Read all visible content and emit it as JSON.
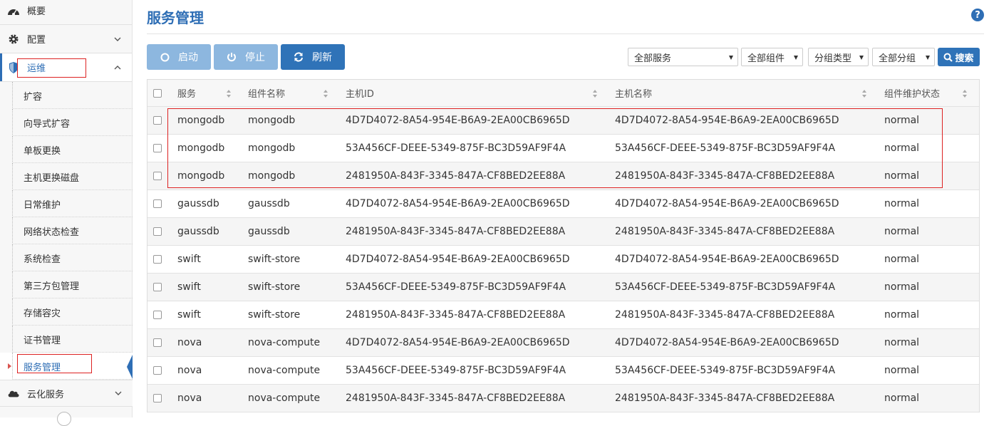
{
  "sidebar": {
    "overview": "概要",
    "config": "配置",
    "ops": "运维",
    "ops_items": [
      {
        "label": "扩容"
      },
      {
        "label": "向导式扩容"
      },
      {
        "label": "单板更换"
      },
      {
        "label": "主机更换磁盘"
      },
      {
        "label": "日常维护"
      },
      {
        "label": "网络状态检查"
      },
      {
        "label": "系统检查"
      },
      {
        "label": "第三方包管理"
      },
      {
        "label": "存储容灾"
      },
      {
        "label": "证书管理"
      },
      {
        "label": "服务管理"
      }
    ],
    "active_item": "服务管理",
    "cloud": "云化服务"
  },
  "page": {
    "title": "服务管理",
    "help": "?"
  },
  "toolbar": {
    "start": "启动",
    "stop": "停止",
    "refresh": "刷新"
  },
  "filters": {
    "service": "全部服务",
    "component": "全部组件",
    "group_type": "分组类型",
    "group": "全部分组",
    "search": "搜索"
  },
  "table": {
    "headers": [
      "服务",
      "组件名称",
      "主机ID",
      "主机名称",
      "组件维护状态"
    ],
    "rows": [
      [
        "mongodb",
        "mongodb",
        "4D7D4072-8A54-954E-B6A9-2EA00CB6965D",
        "4D7D4072-8A54-954E-B6A9-2EA00CB6965D",
        "normal"
      ],
      [
        "mongodb",
        "mongodb",
        "53A456CF-DEEE-5349-875F-BC3D59AF9F4A",
        "53A456CF-DEEE-5349-875F-BC3D59AF9F4A",
        "normal"
      ],
      [
        "mongodb",
        "mongodb",
        "2481950A-843F-3345-847A-CF8BED2EE88A",
        "2481950A-843F-3345-847A-CF8BED2EE88A",
        "normal"
      ],
      [
        "gaussdb",
        "gaussdb",
        "4D7D4072-8A54-954E-B6A9-2EA00CB6965D",
        "4D7D4072-8A54-954E-B6A9-2EA00CB6965D",
        "normal"
      ],
      [
        "gaussdb",
        "gaussdb",
        "2481950A-843F-3345-847A-CF8BED2EE88A",
        "2481950A-843F-3345-847A-CF8BED2EE88A",
        "normal"
      ],
      [
        "swift",
        "swift-store",
        "4D7D4072-8A54-954E-B6A9-2EA00CB6965D",
        "4D7D4072-8A54-954E-B6A9-2EA00CB6965D",
        "normal"
      ],
      [
        "swift",
        "swift-store",
        "53A456CF-DEEE-5349-875F-BC3D59AF9F4A",
        "53A456CF-DEEE-5349-875F-BC3D59AF9F4A",
        "normal"
      ],
      [
        "swift",
        "swift-store",
        "2481950A-843F-3345-847A-CF8BED2EE88A",
        "2481950A-843F-3345-847A-CF8BED2EE88A",
        "normal"
      ],
      [
        "nova",
        "nova-compute",
        "4D7D4072-8A54-954E-B6A9-2EA00CB6965D",
        "4D7D4072-8A54-954E-B6A9-2EA00CB6965D",
        "normal"
      ],
      [
        "nova",
        "nova-compute",
        "53A456CF-DEEE-5349-875F-BC3D59AF9F4A",
        "53A456CF-DEEE-5349-875F-BC3D59AF9F4A",
        "normal"
      ],
      [
        "nova",
        "nova-compute",
        "2481950A-843F-3345-847A-CF8BED2EE88A",
        "2481950A-843F-3345-847A-CF8BED2EE88A",
        "normal"
      ]
    ]
  },
  "colors": {
    "accent": "#2e6eb5",
    "button_disabled": "#8db7df",
    "highlight_box": "#dd2222"
  },
  "icons": {
    "overview": "dashboard-icon",
    "config": "gear-icon",
    "ops": "shield-icon",
    "cloud": "cloud-icon",
    "start": "circle-icon",
    "stop": "power-icon",
    "refresh": "refresh-icon",
    "search": "search-icon",
    "help": "help-icon"
  }
}
